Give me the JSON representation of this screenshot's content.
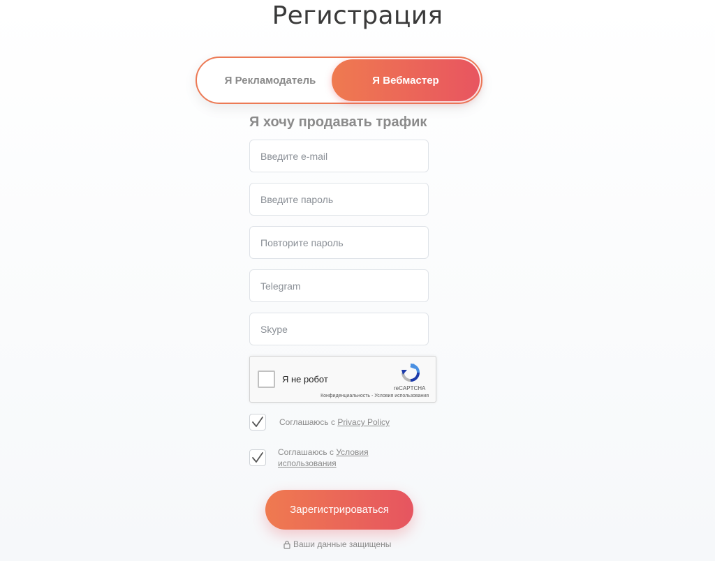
{
  "page": {
    "title": "Регистрация",
    "subtitle": "Я хочу продавать трафик"
  },
  "role_toggle": {
    "advertiser_label": "Я Рекламодатель",
    "webmaster_label": "Я Вебмастер",
    "selected": "webmaster"
  },
  "form": {
    "email_placeholder": "Введите e-mail",
    "password_placeholder": "Введите пароль",
    "repeat_password_placeholder": "Повторите пароль",
    "telegram_placeholder": "Telegram",
    "skype_placeholder": "Skype"
  },
  "captcha": {
    "label": "Я не робот",
    "brand": "reCAPTCHA",
    "links": "Конфиденциальность - Условия использования"
  },
  "agreements": {
    "privacy_prefix": "Соглашаюсь с ",
    "privacy_link": "Privacy Policy",
    "terms_prefix": "Соглашаюсь с ",
    "terms_link": "Условия использования",
    "privacy_checked": true,
    "terms_checked": true
  },
  "submit_label": "Зарегистрироваться",
  "secure_note": "Ваши данные защищены",
  "colors": {
    "accent_start": "#ef7a50",
    "accent_end": "#e85560"
  }
}
